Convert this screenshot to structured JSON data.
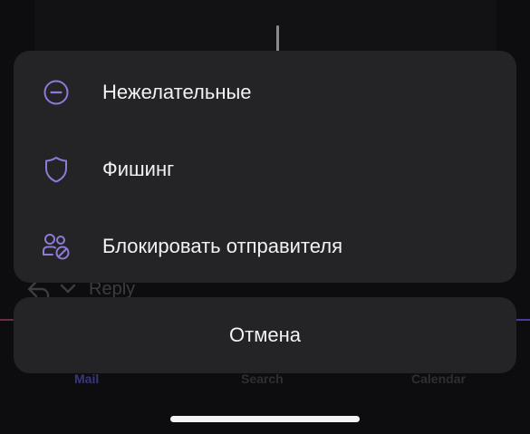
{
  "background": {
    "reply_label": "Reply",
    "tabs": [
      {
        "label": "Mail"
      },
      {
        "label": "Search"
      },
      {
        "label": "Calendar"
      }
    ]
  },
  "sheet": {
    "items": [
      {
        "label": "Нежелательные",
        "icon": "minus-circle-icon"
      },
      {
        "label": "Фишинг",
        "icon": "shield-icon"
      },
      {
        "label": "Блокировать отправителя",
        "icon": "block-people-icon"
      }
    ]
  },
  "cancel": {
    "label": "Отмена"
  },
  "colors": {
    "accent": "#8f7ad8",
    "sheet_bg": "#242326",
    "text": "#f2f2f4"
  }
}
